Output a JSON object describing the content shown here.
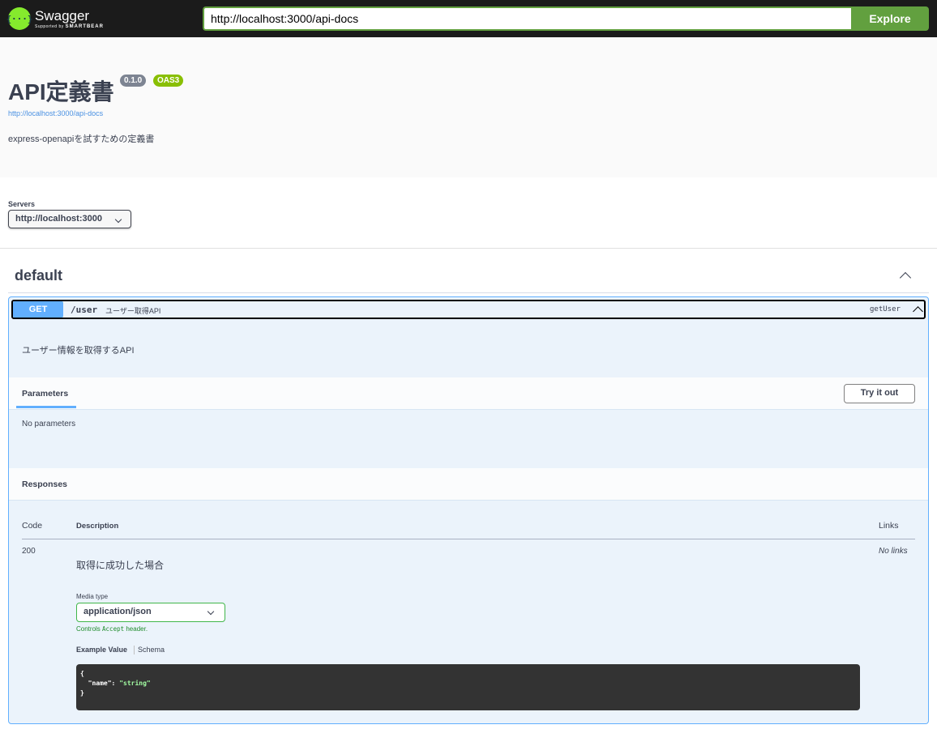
{
  "topbar": {
    "logo_name": "Swagger",
    "logo_sub_prefix": "Supported by",
    "logo_sub_brand": "SMARTBEAR",
    "url_value": "http://localhost:3000/api-docs",
    "explore_label": "Explore"
  },
  "info": {
    "title": "API定義書",
    "version_badge": "0.1.0",
    "oas_badge": "OAS3",
    "link": "http://localhost:3000/api-docs",
    "description": "express-openapiを試すための定義書"
  },
  "servers": {
    "label": "Servers",
    "selected": "http://localhost:3000"
  },
  "tag": {
    "name": "default"
  },
  "operation": {
    "method": "GET",
    "path": "/user",
    "summary": "ユーザー取得API",
    "operation_id": "getUser",
    "description": "ユーザー情報を取得するAPI",
    "parameters_tab": "Parameters",
    "try_it_out_label": "Try it out",
    "no_parameters": "No parameters",
    "responses_title": "Responses",
    "table_headers": {
      "code": "Code",
      "description": "Description",
      "links": "Links"
    },
    "responses": [
      {
        "code": "200",
        "description": "取得に成功した場合",
        "links": "No links",
        "media_type_label": "Media type",
        "media_type": "application/json",
        "controls_prefix": "Controls",
        "controls_code": "Accept",
        "controls_suffix": "header.",
        "example_tab": "Example Value",
        "schema_tab": "Schema",
        "example_open": "{",
        "example_key": "\"name\"",
        "example_value": "\"string\"",
        "example_close": "}"
      }
    ]
  },
  "colors": {
    "get_method": "#61affe",
    "topbar": "#1b1b1b",
    "explore": "#62a03f",
    "oas_badge": "#89bf04",
    "version_badge": "#7d8492"
  }
}
